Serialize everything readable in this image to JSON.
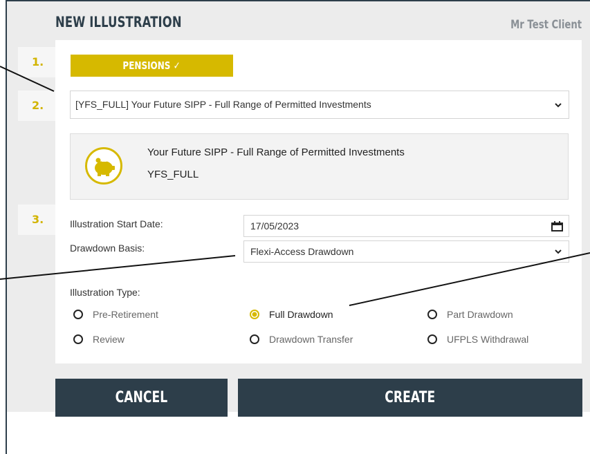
{
  "dialog": {
    "title": "NEW ILLUSTRATION",
    "client_name": "Mr Test Client"
  },
  "steps": [
    "1.",
    "2.",
    "3."
  ],
  "product_badge": "PENSIONS ✓",
  "product_select": {
    "value": "[YFS_FULL] Your Future SIPP - Full Range of Permitted Investments"
  },
  "product_info": {
    "icon": "piggy-bank-icon",
    "name": "Your Future SIPP - Full Range of Permitted Investments",
    "code": "YFS_FULL"
  },
  "form": {
    "start_date_label": "Illustration Start Date:",
    "start_date_value": "17/05/2023",
    "drawdown_basis_label": "Drawdown Basis:",
    "drawdown_basis_value": "Flexi-Access Drawdown",
    "illustration_type_label": "Illustration Type:"
  },
  "illustration_types": [
    {
      "label": "Pre-Retirement",
      "selected": false
    },
    {
      "label": "Full Drawdown",
      "selected": true
    },
    {
      "label": "Part Drawdown",
      "selected": false
    },
    {
      "label": "Review",
      "selected": false
    },
    {
      "label": "Drawdown Transfer",
      "selected": false
    },
    {
      "label": "UFPLS Withdrawal",
      "selected": false
    }
  ],
  "buttons": {
    "cancel": "CANCEL",
    "create": "CREATE"
  },
  "colors": {
    "accent": "#d6b900",
    "dark": "#2d3e4a",
    "panel": "#ececec"
  }
}
